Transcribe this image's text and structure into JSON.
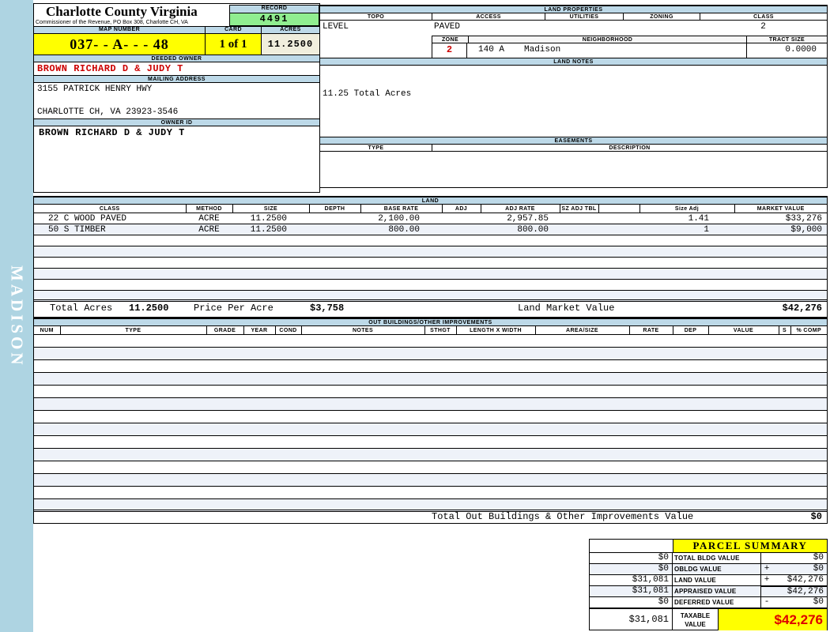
{
  "colors": {
    "accent_yellow": "#ffff00",
    "record_green": "#90ee90",
    "header_blue": "#bdd9e8",
    "sidebar_blue": "#aed4e2",
    "alert_red": "#cc0000",
    "taxable_red": "#dd0000",
    "acres_cream": "#f0eedd"
  },
  "sidebar": {
    "district": "MADISON"
  },
  "header": {
    "county_title": "Charlotte County Virginia",
    "commissioner_line": "Commissioner of the Revenue, PO Box 308, Charlotte CH, VA",
    "record_label": "RECORD",
    "record_value": "4491",
    "map_number_label": "MAP NUMBER",
    "map_number_value": "037- - A- - - 48",
    "card_label": "CARD",
    "card_value": "1 of 1",
    "acres_label": "ACRES",
    "acres_value": "11.2500"
  },
  "owner": {
    "deeded_owner_label": "DEEDED OWNER",
    "deeded_owner": "BROWN RICHARD D & JUDY T",
    "mailing_address_label": "MAILING ADDRESS",
    "address_line1": "3155 PATRICK HENRY HWY",
    "address_line2": "CHARLOTTE CH, VA 23923-3546",
    "owner_id_label": "OWNER ID",
    "owner_id": "BROWN RICHARD D & JUDY T"
  },
  "land_properties": {
    "section_label": "LAND PROPERTIES",
    "topo_label": "TOPO",
    "topo": "LEVEL",
    "access_label": "ACCESS",
    "access": "PAVED",
    "utilities_label": "UTILITIES",
    "zoning_label": "ZONING",
    "class_label": "CLASS",
    "class": "2",
    "zone_label": "ZONE",
    "zone": "2",
    "neighborhood_label": "NEIGHBORHOOD",
    "neighborhood_code": "140 A",
    "neighborhood_name": "Madison",
    "tract_size_label": "TRACT SIZE",
    "tract_size": "0.0000"
  },
  "land_notes": {
    "section_label": "LAND NOTES",
    "note": "11.25 Total Acres"
  },
  "easements": {
    "section_label": "EASEMENTS",
    "type_label": "TYPE",
    "description_label": "DESCRIPTION"
  },
  "land": {
    "section_label": "LAND",
    "columns": [
      "CLASS",
      "METHOD",
      "SIZE",
      "DEPTH",
      "BASE RATE",
      "ADJ",
      "ADJ RATE",
      "SZ ADJ TBL",
      "",
      "Size Adj",
      "MARKET VALUE"
    ],
    "rows": [
      {
        "class": "22 C WOOD PAVED",
        "method": "ACRE",
        "size": "11.2500",
        "depth": "",
        "base_rate": "2,100.00",
        "adj": "",
        "adj_rate": "2,957.85",
        "sz_adj_tbl": "",
        "spacer": "",
        "size_adj": "1.41",
        "market_value": "$33,276"
      },
      {
        "class": "50 S TIMBER",
        "method": "ACRE",
        "size": "11.2500",
        "depth": "",
        "base_rate": "800.00",
        "adj": "",
        "adj_rate": "800.00",
        "sz_adj_tbl": "",
        "spacer": "",
        "size_adj": "1",
        "market_value": "$9,000"
      }
    ],
    "total_acres_label": "Total Acres",
    "total_acres": "11.2500",
    "price_per_acre_label": "Price Per Acre",
    "price_per_acre": "$3,758",
    "land_market_value_label": "Land Market Value",
    "land_market_value": "$42,276"
  },
  "out_buildings": {
    "section_label": "OUT BUILDINGS/OTHER IMPROVEMENTS",
    "columns": [
      "NUM",
      "TYPE",
      "GRADE",
      "YEAR",
      "COND",
      "NOTES",
      "STHGT",
      "LENGTH X WIDTH",
      "AREA/SIZE",
      "RATE",
      "DEP",
      "VALUE",
      "S",
      "% COMP"
    ],
    "total_label": "Total Out Buildings & Other Improvements Value",
    "total_value": "$0"
  },
  "parcel_summary": {
    "title": "PARCEL SUMMARY",
    "rows": [
      {
        "left": "$0",
        "label": "TOTAL BLDG VALUE",
        "op": "",
        "right": "$0"
      },
      {
        "left": "$0",
        "label": "OBLDG VALUE",
        "op": "+",
        "right": "$0"
      },
      {
        "left": "$31,081",
        "label": "LAND VALUE",
        "op": "+",
        "right": "$42,276"
      },
      {
        "left": "$31,081",
        "label": "APPRAISED VALUE",
        "op": "",
        "right": "$42,276"
      },
      {
        "left": "$0",
        "label": "DEFERRED VALUE",
        "op": "-",
        "right": "$0"
      }
    ],
    "taxable": {
      "left": "$31,081",
      "label": "TAXABLE VALUE",
      "value": "$42,276"
    }
  }
}
